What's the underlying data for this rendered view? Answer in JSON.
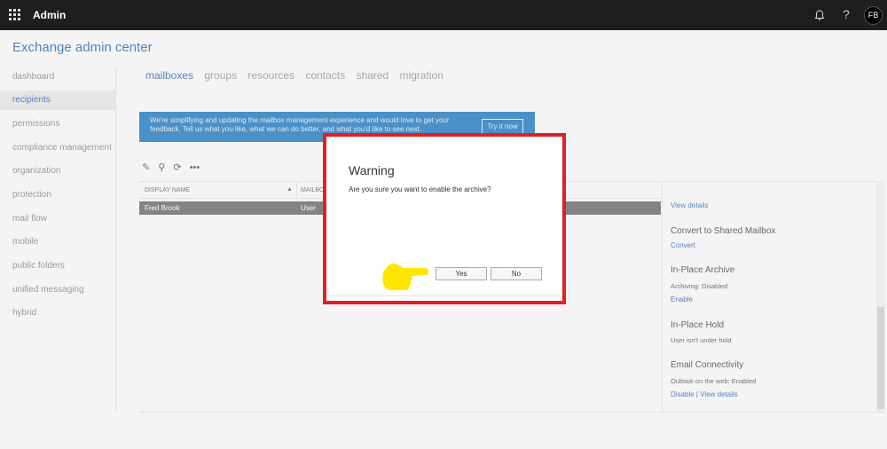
{
  "topbar": {
    "app_title": "Admin",
    "help_label": "?",
    "avatar_initials": "FB"
  },
  "header": {
    "title": "Exchange admin center"
  },
  "sidebar": {
    "items": [
      {
        "label": "dashboard"
      },
      {
        "label": "recipients"
      },
      {
        "label": "permissions"
      },
      {
        "label": "compliance management"
      },
      {
        "label": "organization"
      },
      {
        "label": "protection"
      },
      {
        "label": "mail flow"
      },
      {
        "label": "mobile"
      },
      {
        "label": "public folders"
      },
      {
        "label": "unified messaging"
      },
      {
        "label": "hybrid"
      }
    ],
    "active": "recipients"
  },
  "tabs": {
    "items": [
      {
        "label": "mailboxes"
      },
      {
        "label": "groups"
      },
      {
        "label": "resources"
      },
      {
        "label": "contacts"
      },
      {
        "label": "shared"
      },
      {
        "label": "migration"
      }
    ],
    "active": "mailboxes"
  },
  "banner": {
    "line1": "We're simplifying and updating the mailbox management experience and would love to get your",
    "line2": "feedback. Tell us what you like, what we can do better, and what you'd like to see next.",
    "button": "Try it now"
  },
  "grid": {
    "headers": [
      "DISPLAY NAME",
      "MAILBO"
    ],
    "selected_row": [
      "Fred Brook",
      "User"
    ]
  },
  "details": {
    "view_details": "View details",
    "convert_title": "Convert to Shared Mailbox",
    "convert_link": "Convert",
    "archive_title": "In-Place Archive",
    "archive_status": "Archiving:  Disabled",
    "archive_link": "Enable",
    "hold_title": "In-Place Hold",
    "hold_status": "User isn't under hold",
    "email_title": "Email Connectivity",
    "email_status": "Outlook on the web:  Enabled",
    "email_disable": "Disable",
    "email_sep": "|",
    "email_view": "View details"
  },
  "dialog": {
    "title": "Warning",
    "message": "Are you sure you want to enable the archive?",
    "yes": "Yes",
    "no": "No"
  },
  "colors": {
    "accent": "#1e5aa0",
    "highlight_border": "#e31e24",
    "pointer_hand": "#ffe600"
  }
}
